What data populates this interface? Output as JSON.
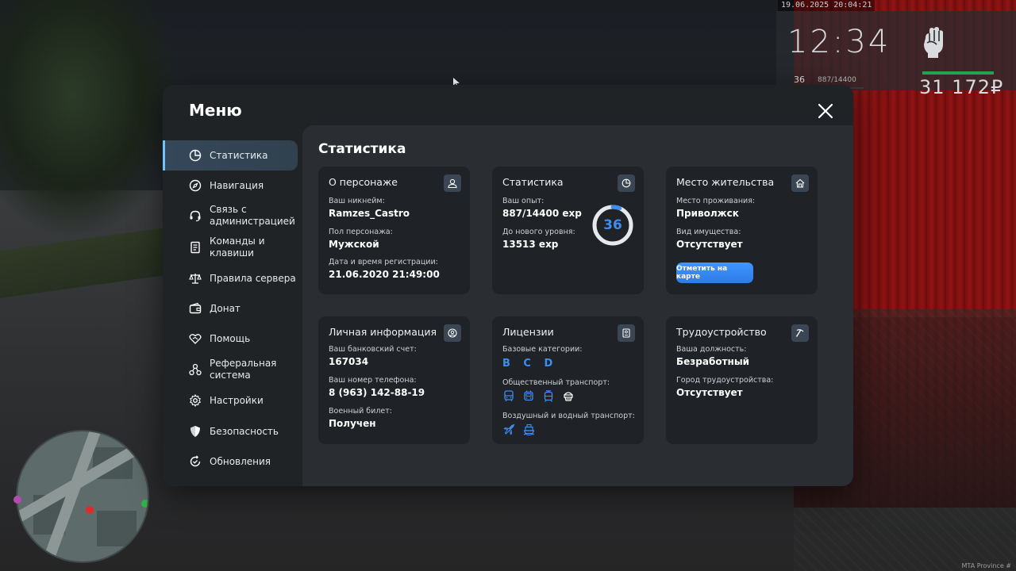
{
  "hud": {
    "datetime": "19.06.2025 20:04:21",
    "clock": "12:34",
    "level": "36",
    "exp": "887/14400",
    "money": "31 172₽",
    "health_fraction": 1.0,
    "level_progress_fraction": 0.0616
  },
  "watermark": "MTA Province #",
  "menu": {
    "title": "Меню",
    "close_icon": "close-icon"
  },
  "sidebar": {
    "items": [
      {
        "label": "Статистика",
        "icon": "pie-chart-icon"
      },
      {
        "label": "Навигация",
        "icon": "compass-icon"
      },
      {
        "label": "Связь с администрацией",
        "icon": "headset-icon"
      },
      {
        "label": "Команды и клавиши",
        "icon": "document-icon"
      },
      {
        "label": "Правила сервера",
        "icon": "scales-icon"
      },
      {
        "label": "Донат",
        "icon": "wallet-icon"
      },
      {
        "label": "Помощь",
        "icon": "handshake-heart-icon"
      },
      {
        "label": "Реферальная система",
        "icon": "network-icon"
      },
      {
        "label": "Настройки",
        "icon": "gear-icon"
      },
      {
        "label": "Безопасность",
        "icon": "shield-icon"
      },
      {
        "label": "Обновления",
        "icon": "refresh-check-icon"
      }
    ],
    "active_index": 0
  },
  "main": {
    "title": "Статистика",
    "character": {
      "title": "О персонаже",
      "nickname_label": "Ваш никнейм:",
      "nickname": "Ramzes_Castro",
      "gender_label": "Пол персонажа:",
      "gender": "Мужской",
      "reg_label": "Дата и время регистрации:",
      "reg_value": "21.06.2020 21:49:00"
    },
    "stats": {
      "title": "Статистика",
      "exp_label": "Ваш опыт:",
      "exp_value": "887/14400 exp",
      "next_label": "До нового уровня:",
      "next_value": "13513 exp",
      "level": "36",
      "level_progress_fraction": 0.0616
    },
    "residence": {
      "title": "Место жительства",
      "place_label": "Место проживания:",
      "place_value": "Приволжск",
      "property_label": "Вид имущества:",
      "property_value": "Отсутствует",
      "map_button": "Отметить на карте"
    },
    "personal": {
      "title": "Личная информация",
      "bank_label": "Ваш банковский счет:",
      "bank_value": "167034",
      "phone_label": "Ваш номер телефона:",
      "phone_value": "8 (963) 142-88-19",
      "military_label": "Военный билет:",
      "military_value": "Получен"
    },
    "licenses": {
      "title": "Лицензии",
      "basic_label": "Базовые категории:",
      "basic_value": "B C D",
      "public_label": "Общественный транспорт:",
      "public_icons": [
        "bus-icon",
        "trolleybus-icon",
        "tram-icon",
        "taxi-icon"
      ],
      "air_water_label": "Воздушный и водный транспорт:",
      "air_water_icons": [
        "airplane-icon",
        "boat-icon"
      ]
    },
    "employment": {
      "title": "Трудоустройство",
      "position_label": "Ваша должность:",
      "position_value": "Безработный",
      "city_label": "Город трудоустройства:",
      "city_value": "Отсутствует"
    }
  },
  "colors": {
    "accent": "#3e8ef0",
    "active_bar": "#6fc4ff",
    "window_bg": "#202326",
    "card_bg": "#1f2226",
    "hud_health": "#23a34f"
  }
}
